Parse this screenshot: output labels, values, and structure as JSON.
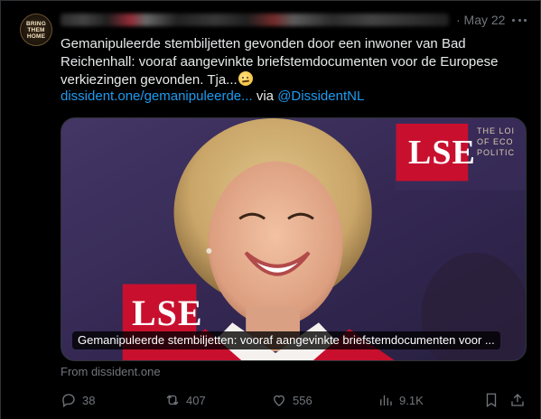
{
  "tweet": {
    "avatar_text": [
      "BRING",
      "THEM",
      "HOME"
    ],
    "date": "· May 22",
    "text": "Gemanipuleerde stembiljetten gevonden door een inwoner van Bad Reichenhall: vooraf aangevinkte briefstemdocumenten voor de Europese verkiezingen gevonden. Tja...",
    "emoji_icon": "slightly-frowning-face-icon",
    "link": "dissident.one/gemanipuleerde...",
    "via_label": "via",
    "mention": "@DissidentNL",
    "card": {
      "sign_text": "LSE",
      "sign_subtext": [
        "THE LOI",
        "OF ECO",
        "POLITIC"
      ],
      "caption": "Gemanipuleerde stembiljetten: vooraf aangevinkte briefstemdocumenten voor ..."
    },
    "source": "From dissident.one"
  },
  "actions": {
    "reply_count": "38",
    "retweet_count": "407",
    "like_count": "556",
    "view_count": "9.1K"
  },
  "colors": {
    "background": "#000000",
    "text": "#e7e9ea",
    "muted": "#71767b",
    "link": "#1d9bf0",
    "lse_red": "#c8102e"
  }
}
